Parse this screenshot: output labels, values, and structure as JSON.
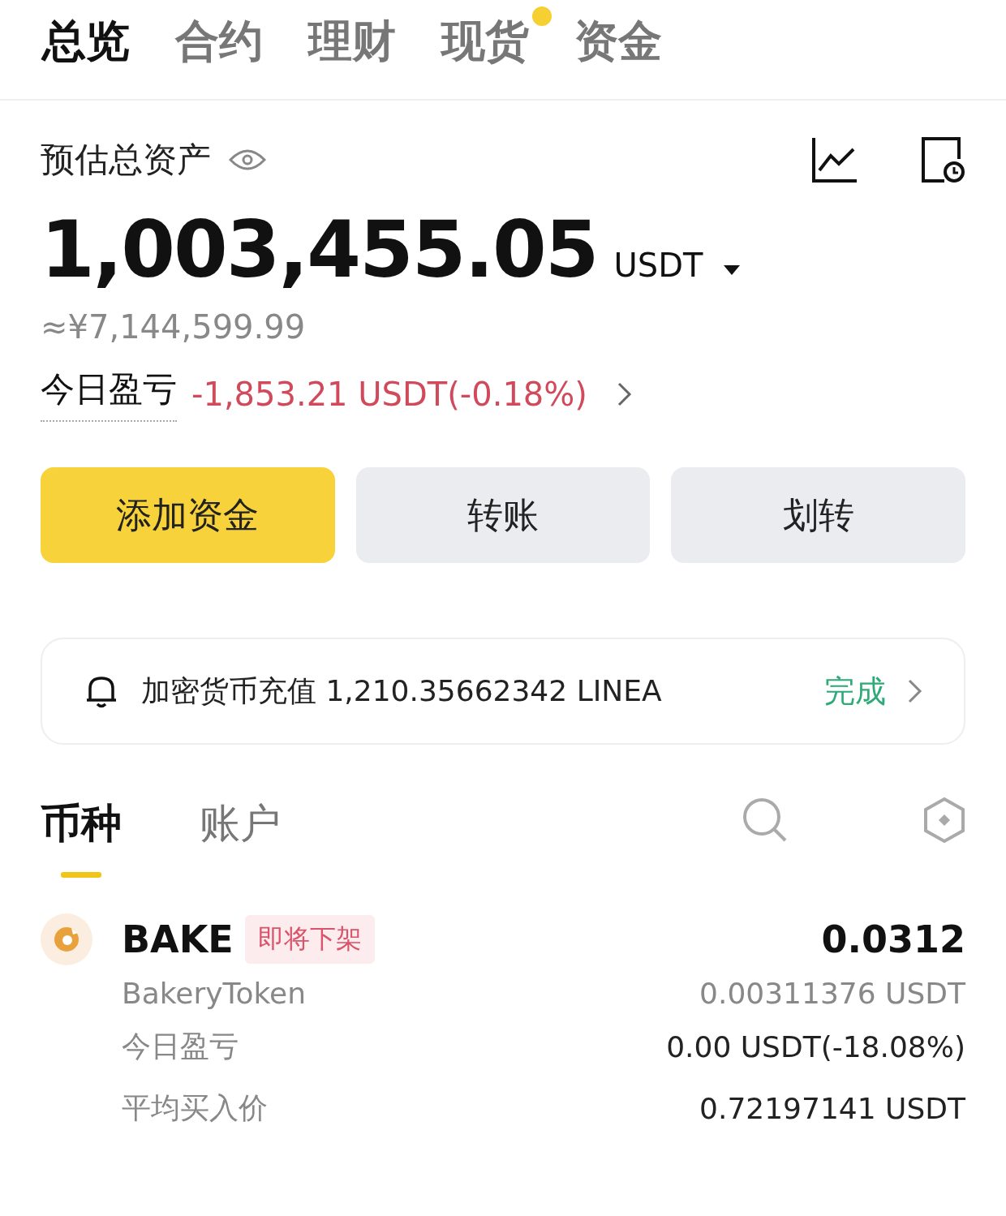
{
  "tabs": [
    {
      "label": "总览",
      "selected": true,
      "dot": false
    },
    {
      "label": "合约",
      "selected": false,
      "dot": false
    },
    {
      "label": "理财",
      "selected": false,
      "dot": false
    },
    {
      "label": "现货",
      "selected": false,
      "dot": true
    },
    {
      "label": "资金",
      "selected": false,
      "dot": false
    }
  ],
  "summary": {
    "title": "预估总资产",
    "total": "1,003,455.05",
    "currency": "USDT",
    "fiat": "≈¥7,144,599.99",
    "pnl_label": "今日盈亏",
    "pnl_value": "-1,853.21 USDT(-0.18%)"
  },
  "actions": [
    {
      "label": "添加资金",
      "primary": true
    },
    {
      "label": "转账",
      "primary": false
    },
    {
      "label": "划转",
      "primary": false
    }
  ],
  "notice": {
    "text": "加密货币充值 1,210.35662342 LINEA",
    "status": "完成"
  },
  "asset_tabs": [
    {
      "label": "币种",
      "selected": true
    },
    {
      "label": "账户",
      "selected": false
    }
  ],
  "assets": [
    {
      "symbol": "BAKE",
      "tag": "即将下架",
      "amount": "0.0312",
      "name": "BakeryToken",
      "value": "0.00311376 USDT",
      "details": [
        {
          "label": "今日盈亏",
          "value": "0.00 USDT(-18.08%)"
        },
        {
          "label": "平均买入价",
          "value": "0.72197141 USDT"
        }
      ]
    }
  ]
}
